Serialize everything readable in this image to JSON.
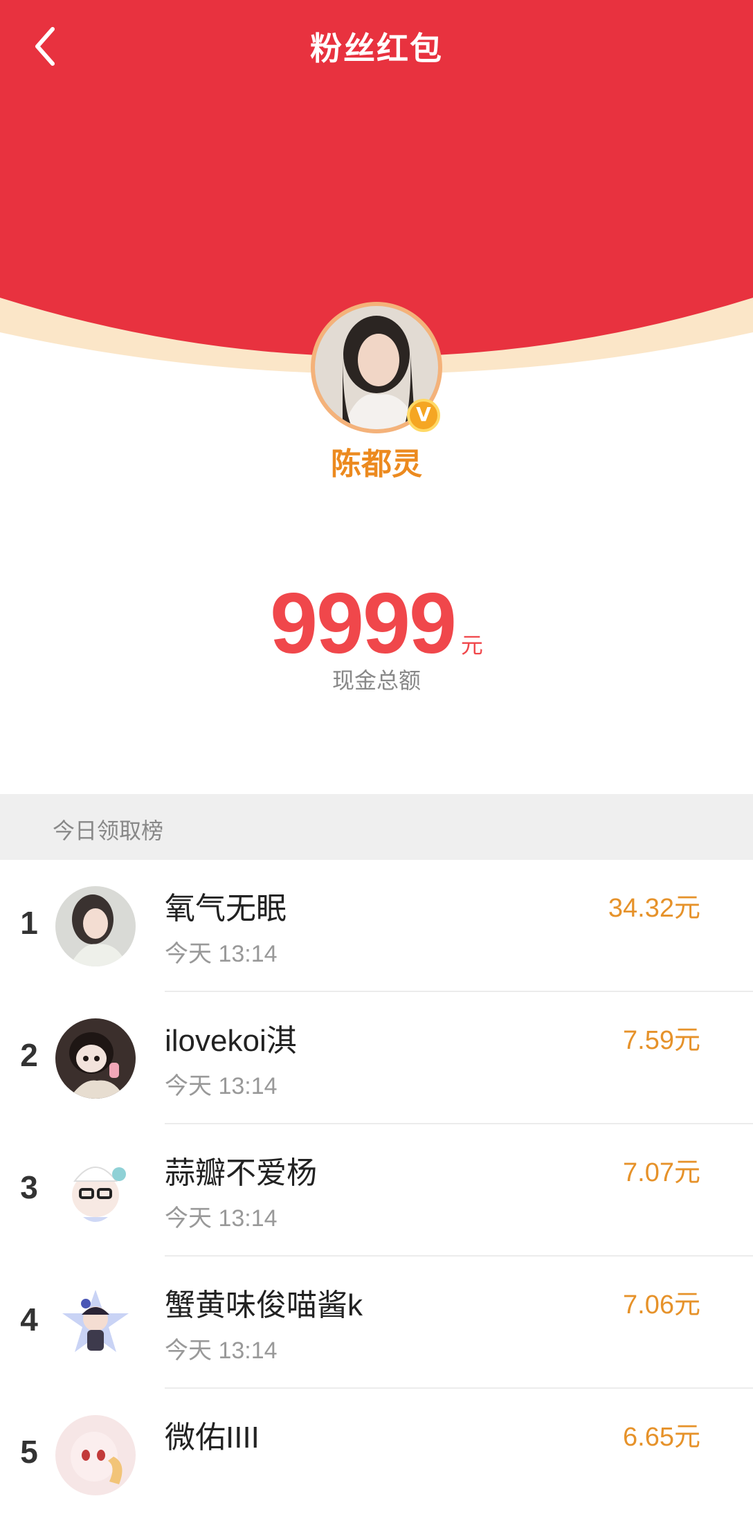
{
  "header": {
    "title": "粉丝红包",
    "back_icon": "chevron-left-icon",
    "bg_color": "#e8323f"
  },
  "profile": {
    "name": "陈都灵",
    "verified_badge": "V",
    "name_color": "#ec8a1f"
  },
  "total": {
    "amount": "9999",
    "unit": "元",
    "label": "现金总额",
    "color": "#f0474b"
  },
  "leaderboard": {
    "title": "今日领取榜",
    "amount_color": "#e6922a",
    "rows": [
      {
        "rank": "1",
        "name": "氧气无眠",
        "time": "今天 13:14",
        "amount": "34.32元"
      },
      {
        "rank": "2",
        "name": "ilovekoi淇",
        "time": "今天 13:14",
        "amount": "7.59元"
      },
      {
        "rank": "3",
        "name": "蒜瓣不爱杨",
        "time": "今天 13:14",
        "amount": "7.07元"
      },
      {
        "rank": "4",
        "name": "蟹黄味俊喵酱k",
        "time": "今天 13:14",
        "amount": "7.06元"
      },
      {
        "rank": "5",
        "name": "微佑IIII",
        "time": "",
        "amount": "6.65元"
      }
    ]
  }
}
